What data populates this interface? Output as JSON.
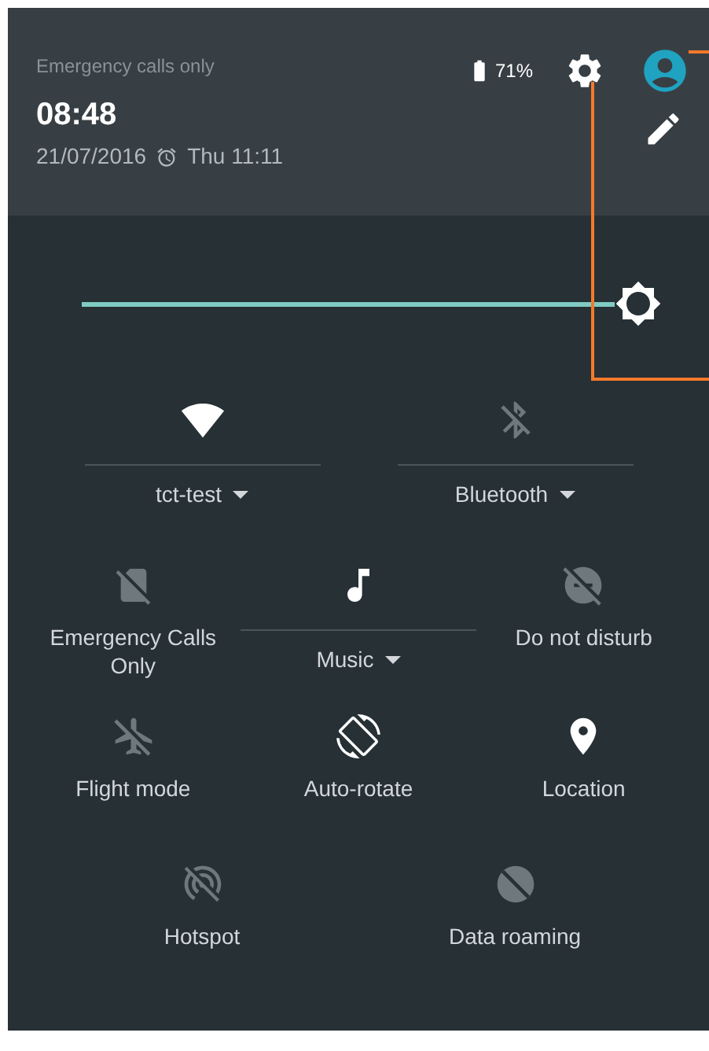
{
  "status": {
    "carrier": "Emergency calls only",
    "battery": "71%",
    "time": "08:48",
    "date": "21/07/2016",
    "alarm": "Thu 11:11"
  },
  "brightness": {
    "level": 1
  },
  "tile_rows": [
    [
      {
        "label": "tct-test",
        "on": true,
        "kind": "dual"
      },
      {
        "label": "Bluetooth",
        "on": false,
        "kind": "dual"
      }
    ],
    [
      {
        "label": "Emergency Calls Only",
        "on": false,
        "kind": "simple"
      },
      {
        "label": "Music",
        "on": true,
        "kind": "dual"
      },
      {
        "label": "Do not disturb",
        "on": false,
        "kind": "simple"
      }
    ],
    [
      {
        "label": "Flight mode",
        "on": false,
        "kind": "simple"
      },
      {
        "label": "Auto-rotate",
        "on": true,
        "kind": "simple"
      },
      {
        "label": "Location",
        "on": true,
        "kind": "simple"
      }
    ],
    [
      {
        "label": "Hotspot",
        "on": false,
        "kind": "simple"
      },
      {
        "label": "Data roaming",
        "on": false,
        "kind": "simple"
      }
    ]
  ]
}
